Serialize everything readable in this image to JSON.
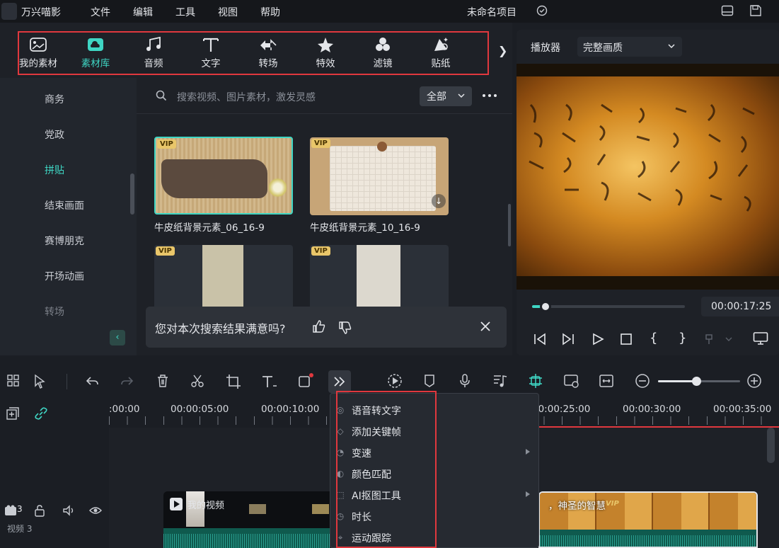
{
  "app": {
    "name": "万兴喵影",
    "project_title": "未命名项目"
  },
  "menu": [
    "文件",
    "编辑",
    "工具",
    "视图",
    "帮助"
  ],
  "categories": [
    {
      "label": "我的素材",
      "icon": "image-icon"
    },
    {
      "label": "素材库",
      "icon": "cloud-library-icon"
    },
    {
      "label": "音频",
      "icon": "music-note-icon"
    },
    {
      "label": "文字",
      "icon": "text-icon"
    },
    {
      "label": "转场",
      "icon": "transition-icon"
    },
    {
      "label": "特效",
      "icon": "sparkle-star-icon"
    },
    {
      "label": "滤镜",
      "icon": "filter-circles-icon"
    },
    {
      "label": "贴纸",
      "icon": "sticker-icon"
    }
  ],
  "categories_more": "❯",
  "sidebar": [
    "商务",
    "党政",
    "拼贴",
    "结束画面",
    "赛博朋克",
    "开场动画",
    "转场"
  ],
  "sidebar_active": "拼贴",
  "search": {
    "placeholder": "搜索视频、图片素材，激发灵感",
    "filter": "全部"
  },
  "media_items": [
    {
      "caption": "牛皮纸背景元素_06_16-9",
      "badge": "VIP"
    },
    {
      "caption": "牛皮纸背景元素_10_16-9",
      "badge": "VIP"
    },
    {
      "caption": "",
      "badge": "VIP"
    },
    {
      "caption": "",
      "badge": "VIP"
    }
  ],
  "feedback": {
    "question": "您对本次搜索结果满意吗?"
  },
  "player": {
    "label": "播放器",
    "quality": "完整画质",
    "timecode": "00:00:17:25",
    "progress": 0.05
  },
  "timeline": {
    "ticks": [
      ":00:00",
      "00:00:05:00",
      "00:00:10:00",
      "00:00:25:00",
      "00:00:30:00",
      "00:00:35:00"
    ],
    "track": {
      "number": "3",
      "name": "视频 3"
    },
    "clips": [
      {
        "title": "我的视频"
      },
      {
        "title": "，神圣的智慧",
        "badge": "VIP"
      }
    ]
  },
  "context_menu": [
    {
      "label": "语音转文字",
      "icon": "speech-to-text-icon",
      "submenu": false
    },
    {
      "label": "添加关键帧",
      "icon": "keyframe-icon",
      "submenu": false
    },
    {
      "label": "变速",
      "icon": "speed-icon",
      "submenu": true
    },
    {
      "label": "颜色匹配",
      "icon": "color-match-icon",
      "submenu": false
    },
    {
      "label": "AI抠图工具",
      "icon": "ai-cutout-icon",
      "submenu": true
    },
    {
      "label": "时长",
      "icon": "duration-icon",
      "submenu": false
    },
    {
      "label": "运动跟踪",
      "icon": "motion-tracking-icon",
      "submenu": false
    }
  ],
  "colors": {
    "accent": "#3fd6c4",
    "highlight_box": "#e0383e",
    "vip": "#e9c66a"
  }
}
